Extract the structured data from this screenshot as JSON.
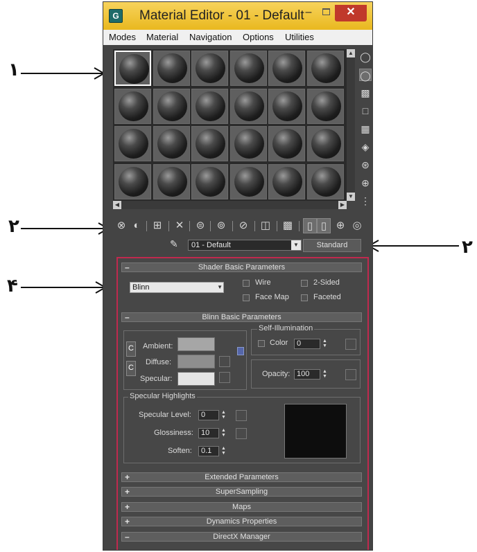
{
  "window": {
    "title": "Material Editor - 01 - Default",
    "app_icon": "3ds-max-icon",
    "minimize": "–",
    "maximize": "",
    "close": "✕"
  },
  "menu": [
    "Modes",
    "Material",
    "Navigation",
    "Options",
    "Utilities"
  ],
  "slots": {
    "rows": 4,
    "cols": 6,
    "selected_index": 0
  },
  "side_toolbar": [
    "sample-type-sphere-icon",
    "backlight-icon",
    "background-checker-icon",
    "sample-uv-tiling-icon",
    "video-color-check-icon",
    "make-preview-icon",
    "options-icon",
    "select-by-material-icon",
    "material-map-navigator-icon"
  ],
  "bottom_toolbar": [
    "get-material-icon",
    "put-to-scene-icon",
    "assign-to-selection-icon",
    "reset-map-icon",
    "copy-material-icon",
    "make-unique-icon",
    "put-to-library-icon",
    "material-id-channel-icon",
    "show-shaded-in-viewport-icon",
    "show-end-result-icon",
    "go-to-parent-icon",
    "go-forward-to-sibling-icon"
  ],
  "material": {
    "name": "01 - Default",
    "type": "Standard"
  },
  "shader": {
    "header": "Shader Basic Parameters",
    "toggle": "–",
    "shader_type": "Blinn",
    "wire": "Wire",
    "two_sided": "2-Sided",
    "face_map": "Face Map",
    "faceted": "Faceted"
  },
  "blinn": {
    "header": "Blinn Basic Parameters",
    "toggle": "–",
    "ambient": "Ambient:",
    "diffuse": "Diffuse:",
    "specular": "Specular:",
    "lock_c": "C",
    "self_illum": "Self-Illumination",
    "color_label": "Color",
    "color_value": "0",
    "opacity_label": "Opacity:",
    "opacity_value": "100",
    "spec_group": "Specular Highlights",
    "spec_level_label": "Specular Level:",
    "spec_level": "0",
    "gloss_label": "Glossiness:",
    "gloss": "10",
    "soften_label": "Soften:",
    "soften": "0.1"
  },
  "rollouts": [
    {
      "label": "Extended Parameters",
      "toggle": "+"
    },
    {
      "label": "SuperSampling",
      "toggle": "+"
    },
    {
      "label": "Maps",
      "toggle": "+"
    },
    {
      "label": "Dynamics Properties",
      "toggle": "+"
    },
    {
      "label": "DirectX Manager",
      "toggle": "–"
    }
  ],
  "annotations": {
    "n1": "١",
    "n2": "٢",
    "n3": "٢",
    "n4": "۴"
  }
}
